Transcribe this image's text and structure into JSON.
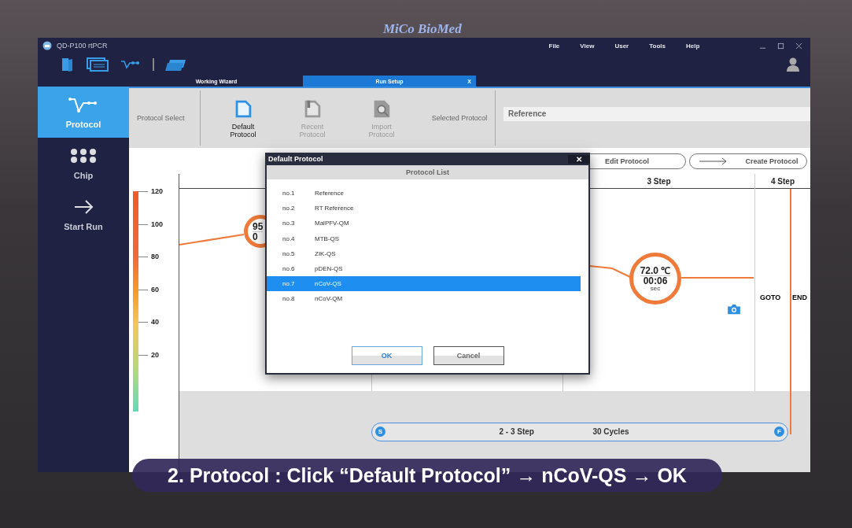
{
  "bezel_brand": "MiCo BioMed",
  "window": {
    "title": "QD-P100 rtPCR"
  },
  "menu": [
    "File",
    "View",
    "User",
    "Tools",
    "Help"
  ],
  "tabs": [
    {
      "label": "Working Wizard",
      "selected": false
    },
    {
      "label": "Run Setup",
      "selected": true,
      "close": "X"
    }
  ],
  "sidebar": [
    {
      "label": "Protocol",
      "selected": true
    },
    {
      "label": "Chip",
      "selected": false
    },
    {
      "label": "Start Run",
      "selected": false
    }
  ],
  "protocol_select": {
    "label": "Protocol Select",
    "buttons": [
      {
        "label": "Default Protocol",
        "disabled": false
      },
      {
        "label": "Recent Protocol",
        "disabled": true
      },
      {
        "label": "Import Protocol",
        "disabled": true
      }
    ],
    "selected_label": "Selected Protocol",
    "selected_value": "Reference"
  },
  "actions": [
    {
      "label": "Edit Protocol",
      "kind": "plain"
    },
    {
      "label": "Create Protocol",
      "kind": "arrow"
    }
  ],
  "scale_ticks": [
    "120",
    "100",
    "80",
    "60",
    "40",
    "20"
  ],
  "step_headers": [
    "3 Step",
    "4 Step"
  ],
  "nodes": [
    {
      "temperature": "95",
      "time": "0"
    },
    {
      "temperature": "72.0 ℃",
      "time": "00:06",
      "unit": "sec"
    }
  ],
  "goto": "GOTO",
  "end": "END",
  "cycle": {
    "start": "S",
    "steps": "2 - 3 Step",
    "cycles": "30 Cycles",
    "finish": "F"
  },
  "dialog": {
    "title": "Default Protocol",
    "close": "✕",
    "list_title": "Protocol List",
    "rows": [
      {
        "no": "no.1",
        "name": "Reference",
        "selected": false
      },
      {
        "no": "no.2",
        "name": "RT Reference",
        "selected": false
      },
      {
        "no": "no.3",
        "name": "MalPFV-QM",
        "selected": false
      },
      {
        "no": "no.4",
        "name": "MTB-QS",
        "selected": false
      },
      {
        "no": "no.5",
        "name": "ZIK-QS",
        "selected": false
      },
      {
        "no": "no.6",
        "name": "pDEN-QS",
        "selected": false
      },
      {
        "no": "no.7",
        "name": "nCoV-QS",
        "selected": true
      },
      {
        "no": "no.8",
        "name": "nCoV-QM",
        "selected": false
      }
    ],
    "buttons": [
      {
        "label": "OK",
        "focused": true
      },
      {
        "label": "Cancel",
        "focused": false
      }
    ]
  },
  "caption": "2. Protocol : Click “Default Protocol” → nCoV-QS → OK"
}
